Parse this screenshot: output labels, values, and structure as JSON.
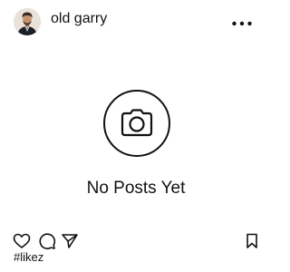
{
  "header": {
    "username": "old garry",
    "avatar_icon": "user-avatar",
    "more_icon": "more-horizontal-icon"
  },
  "media": {
    "empty_icon": "camera-icon",
    "empty_text": "No Posts Yet"
  },
  "actions": {
    "icons": [
      "heart-icon",
      "comment-icon",
      "send-icon",
      "bookmark-icon"
    ]
  },
  "caption": {
    "text": "#likez"
  },
  "colors": {
    "background": "#ffffff",
    "text": "#111111"
  }
}
